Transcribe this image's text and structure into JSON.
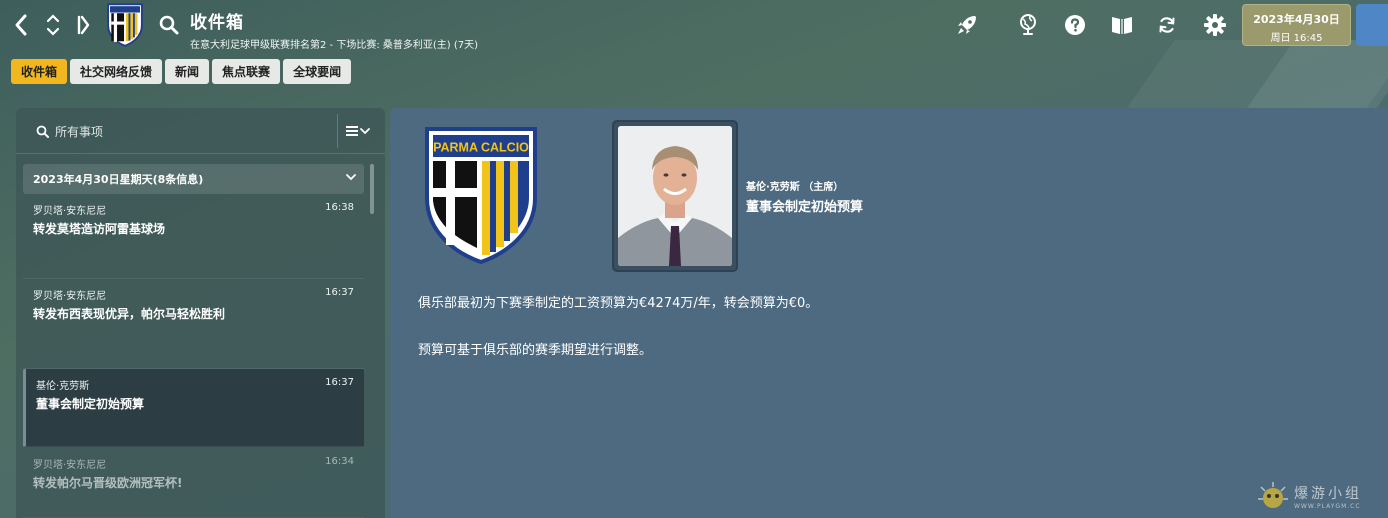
{
  "header": {
    "title": "收件箱",
    "subtitle": "在意大利足球甲级联赛排名第2 - 下场比赛: 桑普多利亚(主) (7天)",
    "crest_text": "PARMA CALCIO"
  },
  "date": {
    "main": "2023年4月30日",
    "sub": "周日 16:45"
  },
  "tabs": [
    {
      "label": "收件箱",
      "active": true
    },
    {
      "label": "社交网络反馈",
      "active": false
    },
    {
      "label": "新闻",
      "active": false
    },
    {
      "label": "焦点联赛",
      "active": false
    },
    {
      "label": "全球要闻",
      "active": false
    }
  ],
  "inbox": {
    "search_placeholder": "所有事项",
    "date_group": "2023年4月30日星期天(8条信息)",
    "messages": [
      {
        "sender": "罗贝塔·安东尼尼",
        "time": "16:38",
        "subject": "转发莫塔造访阿雷基球场",
        "selected": false
      },
      {
        "sender": "罗贝塔·安东尼尼",
        "time": "16:37",
        "subject": "转发布西表现优异，帕尔马轻松胜利",
        "selected": false
      },
      {
        "sender": "基伦·克劳斯",
        "time": "16:37",
        "subject": "董事会制定初始预算",
        "selected": true
      },
      {
        "sender": "罗贝塔·安东尼尼",
        "time": "16:34",
        "subject": "转发帕尔马晋级欧洲冠军杯!",
        "selected": false
      }
    ]
  },
  "message_detail": {
    "sender_role": "基伦·克劳斯 （主席）",
    "title": "董事会制定初始预算",
    "paragraph1": "俱乐部最初为下赛季制定的工资预算为€4274万/年，转会预算为€0。",
    "paragraph2": "预算可基于俱乐部的赛季期望进行调整。"
  },
  "watermark": {
    "text": "爆游小组",
    "url": "WWW.PLAYGM.CC"
  },
  "colors": {
    "accent": "#f2b61e",
    "date_box": "#9a9a6c",
    "continue": "#4f86c6",
    "detail_bg": "#4d6a80",
    "parma_yellow": "#f2c419",
    "parma_blue": "#1f3f8c"
  },
  "icons": [
    "back-icon",
    "up-down-icon",
    "skip-end-icon",
    "search-icon",
    "rocket-icon",
    "globe-icon",
    "help-icon",
    "book-icon",
    "refresh-icon",
    "gear-icon",
    "filter-icon",
    "chevron-down-icon"
  ]
}
